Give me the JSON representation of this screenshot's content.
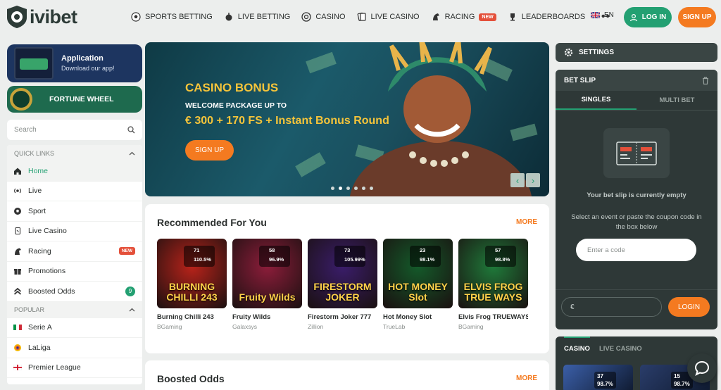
{
  "brand": {
    "name": "ivibet"
  },
  "nav": [
    {
      "label": "SPORTS BETTING",
      "icon": "soccer-ball-icon"
    },
    {
      "label": "LIVE BETTING",
      "icon": "live-icon"
    },
    {
      "label": "CASINO",
      "icon": "casino-chip-icon"
    },
    {
      "label": "LIVE CASINO",
      "icon": "cards-icon"
    },
    {
      "label": "RACING",
      "icon": "horse-icon",
      "badge": "NEW"
    },
    {
      "label": "LEADERBOARDS",
      "icon": "trophy-icon"
    }
  ],
  "nav_more": "•••",
  "header": {
    "lang": "EN",
    "login": "LOG IN",
    "signup": "SIGN UP"
  },
  "promos": {
    "app_title": "Application",
    "app_sub": "Download our app!",
    "wheel": "FORTUNE WHEEL"
  },
  "search": {
    "placeholder": "Search"
  },
  "quick_links": {
    "title": "QUICK LINKS",
    "items": [
      {
        "label": "Home",
        "icon": "home-icon"
      },
      {
        "label": "Live",
        "icon": "live-icon"
      },
      {
        "label": "Sport",
        "icon": "soccer-ball-icon"
      },
      {
        "label": "Live Casino",
        "icon": "cards-icon"
      },
      {
        "label": "Racing",
        "icon": "horse-icon",
        "badge": "NEW"
      },
      {
        "label": "Promotions",
        "icon": "gift-icon"
      },
      {
        "label": "Boosted Odds",
        "icon": "boost-icon",
        "count": "9"
      }
    ]
  },
  "popular": {
    "title": "POPULAR",
    "items": [
      {
        "label": "Serie A",
        "icon": "italy-flag-icon"
      },
      {
        "label": "LaLiga",
        "icon": "laliga-logo-icon"
      },
      {
        "label": "Premier League",
        "icon": "england-flag-icon"
      }
    ]
  },
  "hero": {
    "title": "CASINO BONUS",
    "subtitle": "WELCOME PACKAGE UP TO",
    "amount": "€ 300 + 170 FS + Instant Bonus Round",
    "button": "SIGN UP",
    "slides": 6,
    "active_slide": 1
  },
  "recommended": {
    "title": "Recommended For You",
    "more": "MORE",
    "games": [
      {
        "name": "Burning Chilli 243",
        "provider": "BGaming",
        "players": "71",
        "rtp": "110.5%",
        "art": "BURNING CHILLI 243",
        "color": "#b8231a"
      },
      {
        "name": "Fruity Wilds",
        "provider": "Galaxsys",
        "players": "58",
        "rtp": "96.9%",
        "art": "Fruity Wilds",
        "color": "#8c1d3a"
      },
      {
        "name": "Firestorm Joker 777",
        "provider": "Zillion",
        "players": "73",
        "rtp": "105.99%",
        "art": "FIRESTORM JOKER",
        "color": "#3a1d6a"
      },
      {
        "name": "Hot Money Slot",
        "provider": "TrueLab",
        "players": "23",
        "rtp": "98.1%",
        "art": "HOT MONEY Slot",
        "color": "#145a2a"
      },
      {
        "name": "Elvis Frog TRUEWAYS",
        "provider": "BGaming",
        "players": "57",
        "rtp": "98.8%",
        "art": "ELVIS FROG TRUE WAYS",
        "color": "#1f7a3a"
      }
    ]
  },
  "boosted": {
    "title": "Boosted Odds",
    "more": "MORE"
  },
  "settings": {
    "label": "SETTINGS"
  },
  "betslip": {
    "title": "BET SLIP",
    "tab_singles": "SINGLES",
    "tab_multi": "MULTI BET",
    "empty": "Your bet slip is currently empty",
    "hint": "Select an event or paste the coupon code in the box below",
    "code_placeholder": "Enter a code",
    "currency": "€",
    "login": "LOGIN"
  },
  "casino_box": {
    "tab_casino": "CASINO",
    "tab_live": "LIVE CASINO",
    "games": [
      {
        "players": "37",
        "rtp": "98.7%",
        "color": "#3b5fa8"
      },
      {
        "players": "15",
        "rtp": "98.7%",
        "color": "#2a3d6a"
      }
    ]
  }
}
